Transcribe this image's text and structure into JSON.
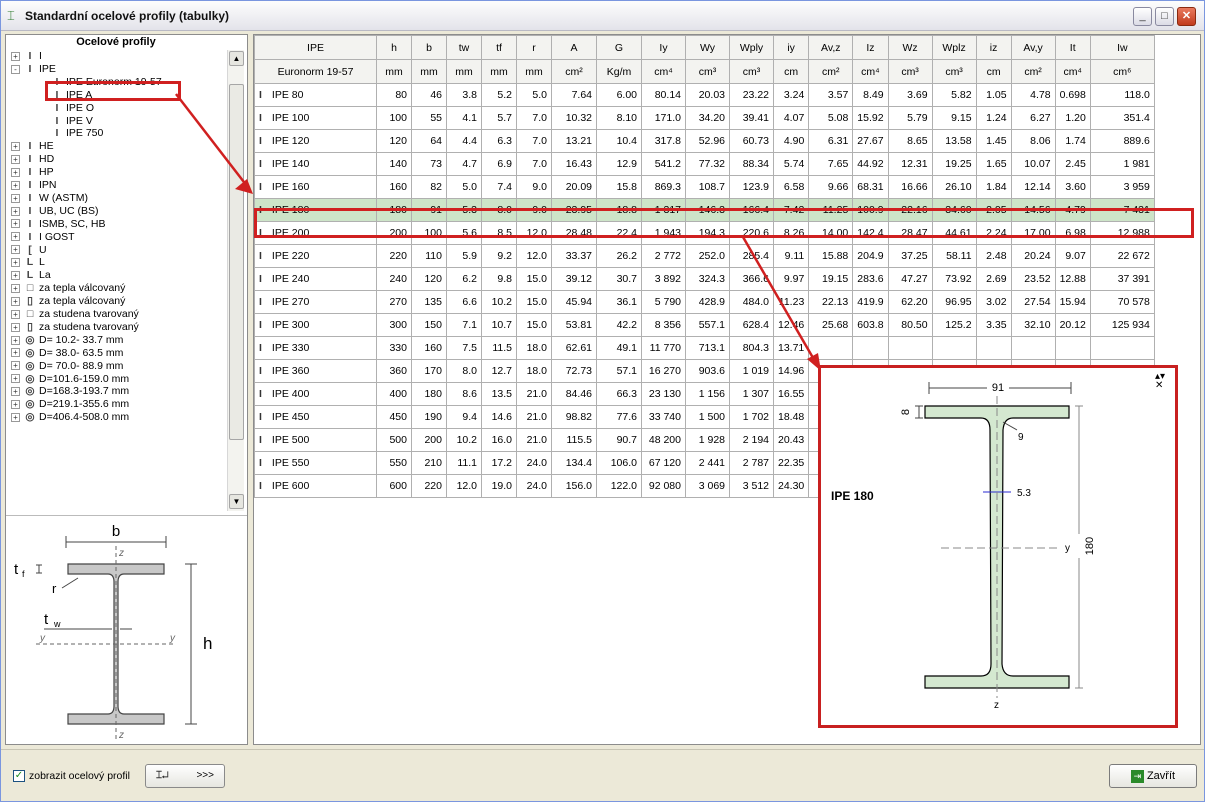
{
  "window": {
    "title": "Standardní ocelové profily (tabulky)"
  },
  "tree": {
    "header": "Ocelové profily",
    "items": [
      {
        "label": "I",
        "icon": "i-beam-icon",
        "level": 0,
        "expander": "+"
      },
      {
        "label": "IPE",
        "icon": "i-beam-icon",
        "level": 0,
        "expander": "-"
      },
      {
        "label": "IPE  Euronorm 19-57",
        "icon": "i-beam-icon",
        "level": 1,
        "expander": ""
      },
      {
        "label": "IPE A",
        "icon": "i-beam-icon",
        "level": 1,
        "expander": ""
      },
      {
        "label": "IPE O",
        "icon": "i-beam-icon",
        "level": 1,
        "expander": ""
      },
      {
        "label": "IPE V",
        "icon": "i-beam-icon",
        "level": 1,
        "expander": ""
      },
      {
        "label": "IPE 750",
        "icon": "i-beam-icon",
        "level": 1,
        "expander": ""
      },
      {
        "label": "HE",
        "icon": "i-beam-icon",
        "level": 0,
        "expander": "+"
      },
      {
        "label": "HD",
        "icon": "i-beam-icon",
        "level": 0,
        "expander": "+"
      },
      {
        "label": "HP",
        "icon": "i-beam-icon",
        "level": 0,
        "expander": "+"
      },
      {
        "label": "IPN",
        "icon": "i-beam-icon",
        "level": 0,
        "expander": "+"
      },
      {
        "label": "W (ASTM)",
        "icon": "i-beam-icon",
        "level": 0,
        "expander": "+"
      },
      {
        "label": "UB, UC (BS)",
        "icon": "i-beam-icon",
        "level": 0,
        "expander": "+"
      },
      {
        "label": "ISMB, SC, HB",
        "icon": "i-beam-icon",
        "level": 0,
        "expander": "+"
      },
      {
        "label": "I GOST",
        "icon": "i-beam-icon",
        "level": 0,
        "expander": "+"
      },
      {
        "label": "U",
        "icon": "channel-icon",
        "level": 0,
        "expander": "+"
      },
      {
        "label": "L",
        "icon": "angle-icon",
        "level": 0,
        "expander": "+"
      },
      {
        "label": "La",
        "icon": "angle-icon",
        "level": 0,
        "expander": "+"
      },
      {
        "label": "za tepla válcovaný",
        "icon": "square-tube-icon",
        "level": 0,
        "expander": "+"
      },
      {
        "label": "za tepla válcovaný",
        "icon": "rect-tube-icon",
        "level": 0,
        "expander": "+"
      },
      {
        "label": "za studena tvarovaný",
        "icon": "square-tube-icon",
        "level": 0,
        "expander": "+"
      },
      {
        "label": "za studena tvarovaný",
        "icon": "rect-tube-icon",
        "level": 0,
        "expander": "+"
      },
      {
        "label": "D= 10.2- 33.7 mm",
        "icon": "round-tube-icon",
        "level": 0,
        "expander": "+"
      },
      {
        "label": "D= 38.0- 63.5 mm",
        "icon": "round-tube-icon",
        "level": 0,
        "expander": "+"
      },
      {
        "label": "D= 70.0- 88.9 mm",
        "icon": "round-tube-icon",
        "level": 0,
        "expander": "+"
      },
      {
        "label": "D=101.6-159.0 mm",
        "icon": "round-tube-icon",
        "level": 0,
        "expander": "+"
      },
      {
        "label": "D=168.3-193.7 mm",
        "icon": "round-tube-icon",
        "level": 0,
        "expander": "+"
      },
      {
        "label": "D=219.1-355.6 mm",
        "icon": "round-tube-icon",
        "level": 0,
        "expander": "+"
      },
      {
        "label": "D=406.4-508.0 mm",
        "icon": "round-tube-icon",
        "level": 0,
        "expander": "+"
      }
    ]
  },
  "diagram": {
    "b": "b",
    "tf": "t",
    "tf_sub": "f",
    "r": "r",
    "tw": "t",
    "tw_sub": "w",
    "y": "y",
    "z": "z",
    "h": "h"
  },
  "table": {
    "header1": [
      "IPE",
      "h",
      "b",
      "tw",
      "tf",
      "r",
      "A",
      "G",
      "Iy",
      "Wy",
      "Wply",
      "iy",
      "Av,z",
      "Iz",
      "Wz",
      "Wplz",
      "iz",
      "Av,y",
      "It",
      "Iw"
    ],
    "header2": [
      "Euronorm 19-57",
      "mm",
      "mm",
      "mm",
      "mm",
      "mm",
      "cm²",
      "Kg/m",
      "cm⁴",
      "cm³",
      "cm³",
      "cm",
      "cm²",
      "cm⁴",
      "cm³",
      "cm³",
      "cm",
      "cm²",
      "cm⁴",
      "cm⁶"
    ],
    "rows": [
      [
        "IPE 80",
        "80",
        "46",
        "3.8",
        "5.2",
        "5.0",
        "7.64",
        "6.00",
        "80.14",
        "20.03",
        "23.22",
        "3.24",
        "3.57",
        "8.49",
        "3.69",
        "5.82",
        "1.05",
        "4.78",
        "0.698",
        "118.0"
      ],
      [
        "IPE 100",
        "100",
        "55",
        "4.1",
        "5.7",
        "7.0",
        "10.32",
        "8.10",
        "171.0",
        "34.20",
        "39.41",
        "4.07",
        "5.08",
        "15.92",
        "5.79",
        "9.15",
        "1.24",
        "6.27",
        "1.20",
        "351.4"
      ],
      [
        "IPE 120",
        "120",
        "64",
        "4.4",
        "6.3",
        "7.0",
        "13.21",
        "10.4",
        "317.8",
        "52.96",
        "60.73",
        "4.90",
        "6.31",
        "27.67",
        "8.65",
        "13.58",
        "1.45",
        "8.06",
        "1.74",
        "889.6"
      ],
      [
        "IPE 140",
        "140",
        "73",
        "4.7",
        "6.9",
        "7.0",
        "16.43",
        "12.9",
        "541.2",
        "77.32",
        "88.34",
        "5.74",
        "7.65",
        "44.92",
        "12.31",
        "19.25",
        "1.65",
        "10.07",
        "2.45",
        "1 981"
      ],
      [
        "IPE 160",
        "160",
        "82",
        "5.0",
        "7.4",
        "9.0",
        "20.09",
        "15.8",
        "869.3",
        "108.7",
        "123.9",
        "6.58",
        "9.66",
        "68.31",
        "16.66",
        "26.10",
        "1.84",
        "12.14",
        "3.60",
        "3 959"
      ],
      [
        "IPE 180",
        "180",
        "91",
        "5.3",
        "8.0",
        "9.0",
        "23.95",
        "18.8",
        "1 317",
        "146.3",
        "166.4",
        "7.42",
        "11.25",
        "100.9",
        "22.16",
        "34.60",
        "2.05",
        "14.56",
        "4.79",
        "7 431"
      ],
      [
        "IPE 200",
        "200",
        "100",
        "5.6",
        "8.5",
        "12.0",
        "28.48",
        "22.4",
        "1 943",
        "194.3",
        "220.6",
        "8.26",
        "14.00",
        "142.4",
        "28.47",
        "44.61",
        "2.24",
        "17.00",
        "6.98",
        "12 988"
      ],
      [
        "IPE 220",
        "220",
        "110",
        "5.9",
        "9.2",
        "12.0",
        "33.37",
        "26.2",
        "2 772",
        "252.0",
        "285.4",
        "9.11",
        "15.88",
        "204.9",
        "37.25",
        "58.11",
        "2.48",
        "20.24",
        "9.07",
        "22 672"
      ],
      [
        "IPE 240",
        "240",
        "120",
        "6.2",
        "9.8",
        "15.0",
        "39.12",
        "30.7",
        "3 892",
        "324.3",
        "366.6",
        "9.97",
        "19.15",
        "283.6",
        "47.27",
        "73.92",
        "2.69",
        "23.52",
        "12.88",
        "37 391"
      ],
      [
        "IPE 270",
        "270",
        "135",
        "6.6",
        "10.2",
        "15.0",
        "45.94",
        "36.1",
        "5 790",
        "428.9",
        "484.0",
        "11.23",
        "22.13",
        "419.9",
        "62.20",
        "96.95",
        "3.02",
        "27.54",
        "15.94",
        "70 578"
      ],
      [
        "IPE 300",
        "300",
        "150",
        "7.1",
        "10.7",
        "15.0",
        "53.81",
        "42.2",
        "8 356",
        "557.1",
        "628.4",
        "12.46",
        "25.68",
        "603.8",
        "80.50",
        "125.2",
        "3.35",
        "32.10",
        "20.12",
        "125 934"
      ],
      [
        "IPE 330",
        "330",
        "160",
        "7.5",
        "11.5",
        "18.0",
        "62.61",
        "49.1",
        "11 770",
        "713.1",
        "804.3",
        "13.71",
        "",
        "",
        "",
        "",
        "",
        "",
        "",
        ""
      ],
      [
        "IPE 360",
        "360",
        "170",
        "8.0",
        "12.7",
        "18.0",
        "72.73",
        "57.1",
        "16 270",
        "903.6",
        "1 019",
        "14.96",
        "",
        "",
        "",
        "",
        "",
        "",
        "",
        ""
      ],
      [
        "IPE 400",
        "400",
        "180",
        "8.6",
        "13.5",
        "21.0",
        "84.46",
        "66.3",
        "23 130",
        "1 156",
        "1 307",
        "16.55",
        "",
        "",
        "",
        "",
        "",
        "",
        "",
        ""
      ],
      [
        "IPE 450",
        "450",
        "190",
        "9.4",
        "14.6",
        "21.0",
        "98.82",
        "77.6",
        "33 740",
        "1 500",
        "1 702",
        "18.48",
        "",
        "",
        "",
        "",
        "",
        "",
        "",
        ""
      ],
      [
        "IPE 500",
        "500",
        "200",
        "10.2",
        "16.0",
        "21.0",
        "115.5",
        "90.7",
        "48 200",
        "1 928",
        "2 194",
        "20.43",
        "",
        "",
        "",
        "",
        "",
        "",
        "",
        ""
      ],
      [
        "IPE 550",
        "550",
        "210",
        "11.1",
        "17.2",
        "24.0",
        "134.4",
        "106.0",
        "67 120",
        "2 441",
        "2 787",
        "22.35",
        "",
        "",
        "",
        "",
        "",
        "",
        "",
        ""
      ],
      [
        "IPE 600",
        "600",
        "220",
        "12.0",
        "19.0",
        "24.0",
        "156.0",
        "122.0",
        "92 080",
        "3 069",
        "3 512",
        "24.30",
        "",
        "",
        "",
        "",
        "",
        "",
        "",
        ""
      ]
    ],
    "selected_row": 5
  },
  "popup": {
    "profile": "IPE 180",
    "b": "91",
    "h": "180",
    "tf": "8",
    "tw": "5.3",
    "r": "9",
    "y": "y",
    "z": "z"
  },
  "bottom": {
    "checkbox_label": "zobrazit ocelový profil",
    "checkbox_checked": true,
    "profile_button_label": ">>>",
    "close_label": "Zavřít"
  },
  "colors": {
    "selection": "#cde4c8",
    "highlight": "#d02020",
    "section_fill": "#d4e8d0"
  }
}
